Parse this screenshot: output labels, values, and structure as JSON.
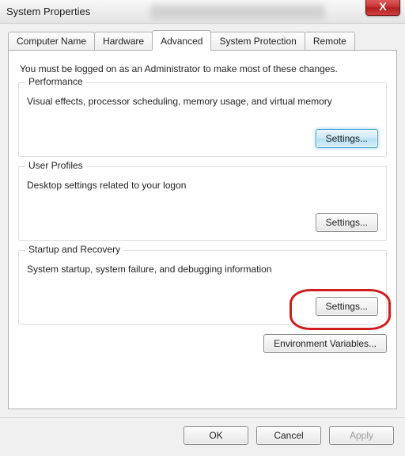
{
  "title": "System Properties",
  "close_symbol": "X",
  "tabs": {
    "computer_name": "Computer Name",
    "hardware": "Hardware",
    "advanced": "Advanced",
    "system_protection": "System Protection",
    "remote": "Remote"
  },
  "intro": "You must be logged on as an Administrator to make most of these changes.",
  "groups": {
    "performance": {
      "title": "Performance",
      "text": "Visual effects, processor scheduling, memory usage, and virtual memory",
      "button": "Settings..."
    },
    "user_profiles": {
      "title": "User Profiles",
      "text": "Desktop settings related to your logon",
      "button": "Settings..."
    },
    "startup_recovery": {
      "title": "Startup and Recovery",
      "text": "System startup, system failure, and debugging information",
      "button": "Settings..."
    }
  },
  "env_button": "Environment Variables...",
  "dialog_buttons": {
    "ok": "OK",
    "cancel": "Cancel",
    "apply": "Apply"
  }
}
